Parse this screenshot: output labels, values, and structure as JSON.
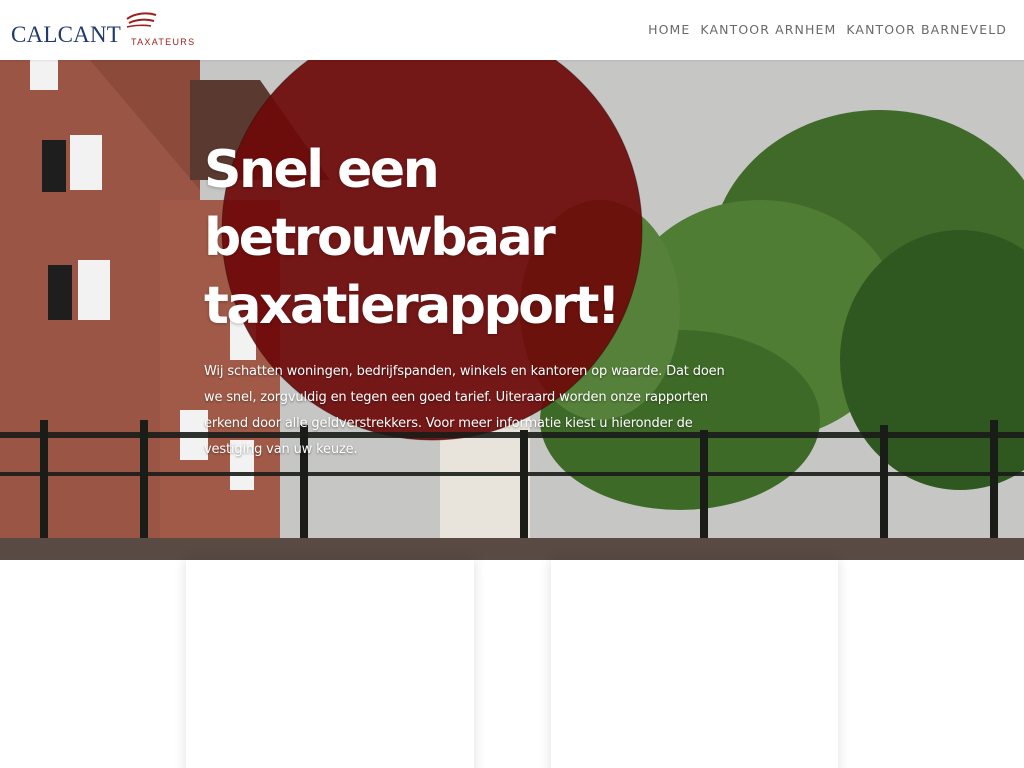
{
  "header": {
    "logo_text": "CALCANT",
    "logo_subtext": "TAXATEURS"
  },
  "nav": {
    "items": [
      "HOME",
      "KANTOOR ARNHEM",
      "KANTOOR BARNEVELD"
    ]
  },
  "hero": {
    "title": "Snel een betrouwbaar taxatierapport!",
    "text": "Wij schatten woningen, bedrijfspanden, winkels en kantoren op waarde. Dat doen we snel, zorgvuldig en tegen een goed tarief. Uiteraard worden onze rapporten erkend door alle geldverstrekkers. Voor meer informatie kiest u hieronder de vestiging van uw keuze."
  },
  "colors": {
    "brand_blue": "#1e3a6e",
    "brand_red": "#a01e1e",
    "hero_circle": "#6e0a0a",
    "nav_text": "#6a6a6a"
  }
}
